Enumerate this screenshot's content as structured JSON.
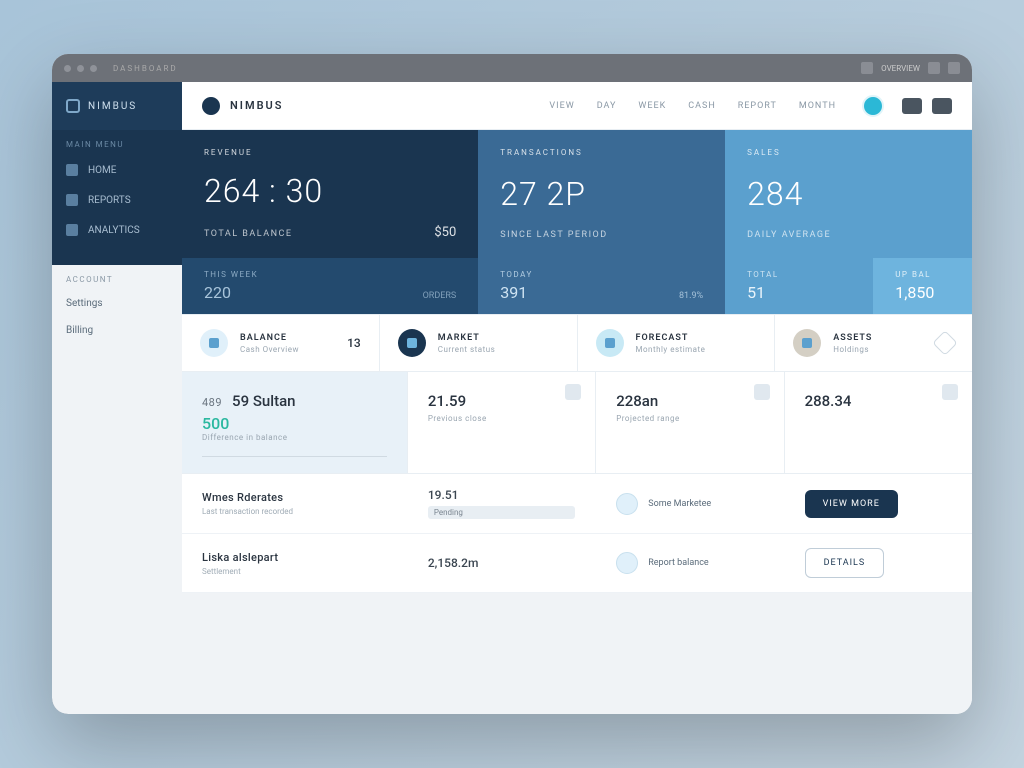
{
  "chrome": {
    "url_hint": "DASHBOARD",
    "right_label": "OVERVIEW"
  },
  "sidebar": {
    "brand": "NIMBUS",
    "section1_label": "MAIN MENU",
    "items": [
      {
        "label": "HOME"
      },
      {
        "label": "REPORTS"
      },
      {
        "label": "ANALYTICS"
      }
    ],
    "section2_label": "ACCOUNT",
    "items2": [
      {
        "label": "Settings"
      },
      {
        "label": "Billing"
      }
    ]
  },
  "topbar": {
    "title": "NIMBUS",
    "nav": [
      "VIEW",
      "DAY",
      "WEEK",
      "CASH",
      "REPORT",
      "MONTH"
    ]
  },
  "stats": [
    {
      "label": "REVENUE",
      "value": "264 : 30",
      "foot": "TOTAL BALANCE",
      "sm": "$50"
    },
    {
      "label": "TRANSACTIONS",
      "value": "27 2P",
      "foot": "SINCE LAST PERIOD"
    },
    {
      "label": "SALES",
      "value": "284",
      "foot": "DAILY AVERAGE"
    }
  ],
  "substats": [
    {
      "label": "THIS WEEK",
      "value": "220",
      "extra": "ORDERS"
    },
    {
      "label": "TODAY",
      "value": "391",
      "extra": "81.9%"
    },
    {
      "label": "TOTAL",
      "value": "51"
    },
    {
      "label": "UP BAL",
      "value": "1,850"
    }
  ],
  "cards4": [
    {
      "title": "BALANCE",
      "sub": "Cash Overview",
      "num": "13"
    },
    {
      "title": "MARKET",
      "sub": "Current status"
    },
    {
      "title": "FORECAST",
      "sub": "Monthly estimate"
    },
    {
      "title": "ASSETS",
      "sub": "Holdings"
    }
  ],
  "metrics": [
    {
      "top": "489",
      "big": "59 Sultan",
      "accent": "500",
      "sub": "Difference in balance"
    },
    {
      "big": "21.59",
      "sub": "Previous close"
    },
    {
      "big": "228an",
      "sub": "Projected range"
    },
    {
      "big": "288.34",
      "sub": ""
    }
  ],
  "list": [
    {
      "title": "Wmes Rderates",
      "sub": "Last transaction recorded",
      "val": "19.51",
      "val_sub": "Pending",
      "badge": "Some Marketee",
      "btn": "VIEW MORE"
    },
    {
      "title": "Liska alslepart",
      "sub": "Settlement",
      "val": "2,158.2m",
      "val_sub": "",
      "badge": "Report balance",
      "btn": "DETAILS"
    }
  ],
  "colors": {
    "dark": "#1a3550",
    "mid": "#3a6a95",
    "light": "#5ba0ce",
    "accent": "#2bb8d6"
  }
}
